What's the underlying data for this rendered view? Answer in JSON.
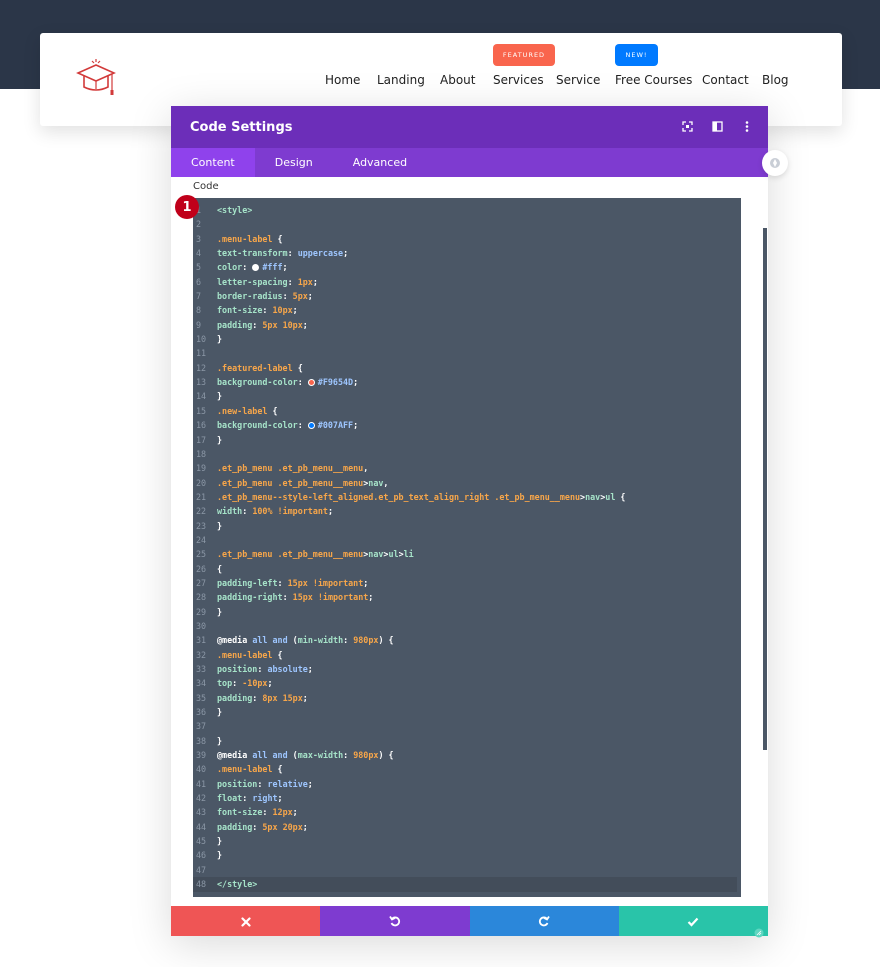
{
  "nav": {
    "items": [
      {
        "label": "Home"
      },
      {
        "label": "Landing"
      },
      {
        "label": "About"
      },
      {
        "label": "Services",
        "badge": "FEATURED",
        "badge_color": "#f9654d"
      },
      {
        "label": "Service"
      },
      {
        "label": "Free Courses",
        "badge": "NEW!",
        "badge_color": "#007aff"
      },
      {
        "label": "Contact"
      },
      {
        "label": "Blog"
      }
    ]
  },
  "modal": {
    "title": "Code Settings",
    "tabs": [
      "Content",
      "Design",
      "Advanced"
    ],
    "active_tab": "Content",
    "field_label": "Code",
    "step_badge": "1"
  },
  "code": {
    "lines": [
      "<style>",
      "",
      ".menu-label {",
      "text-transform: uppercase;",
      "color: #fff;",
      "letter-spacing: 1px;",
      "border-radius: 5px;",
      "font-size: 10px;",
      "padding: 5px 10px;",
      "}",
      "",
      ".featured-label {",
      "background-color: #F9654D;",
      "}",
      ".new-label {",
      "background-color: #007AFF;",
      "}",
      "",
      ".et_pb_menu .et_pb_menu__menu,",
      ".et_pb_menu .et_pb_menu__menu>nav,",
      ".et_pb_menu--style-left_aligned.et_pb_text_align_right .et_pb_menu__menu>nav>ul {",
      "width: 100% !important;",
      "}",
      "",
      ".et_pb_menu .et_pb_menu__menu>nav>ul>li",
      "{",
      "padding-left: 15px !important;",
      "padding-right: 15px !important;",
      "}",
      "",
      "@media all and (min-width: 980px) {",
      ".menu-label {",
      "position: absolute;",
      "top: -10px;",
      "padding: 8px 15px;",
      "}",
      "",
      "}",
      "@media all and (max-width: 980px) {",
      ".menu-label {",
      "position: relative;",
      "float: right;",
      "font-size: 12px;",
      "padding: 5px 20px;",
      "}",
      "}",
      "",
      "</style>"
    ]
  },
  "colors": {
    "header_band": "#2b3648",
    "modal_header": "#6c2eb9",
    "modal_tabs": "#7e3bd0",
    "editor_bg": "#4b5766",
    "cancel": "#ef5555",
    "undo": "#7e3bd0",
    "redo": "#2b87da",
    "save": "#29c4a9"
  },
  "icons": {
    "header": [
      "expand-icon",
      "split-view-icon",
      "more-vertical-icon"
    ],
    "footer": [
      "close-icon",
      "undo-icon",
      "redo-icon",
      "check-icon"
    ]
  }
}
